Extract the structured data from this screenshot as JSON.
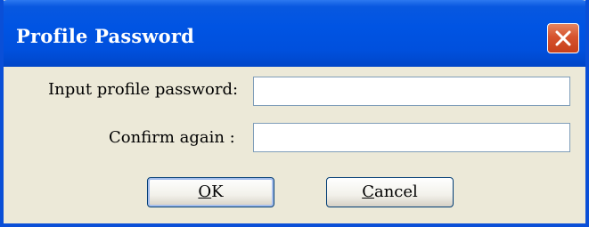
{
  "window": {
    "title": "Profile Password",
    "close_icon": "close-icon"
  },
  "form": {
    "password_label": "Input profile password:",
    "password_value": "",
    "confirm_label": "Confirm again :",
    "confirm_value": ""
  },
  "buttons": {
    "ok_mnemonic": "O",
    "ok_rest": "K",
    "cancel_mnemonic": "C",
    "cancel_rest": "ancel"
  },
  "colors": {
    "titlebar": "#0054E3",
    "close_button": "#D6532E",
    "dialog_bg": "#ECE9D8",
    "input_border": "#7F9DB9"
  }
}
